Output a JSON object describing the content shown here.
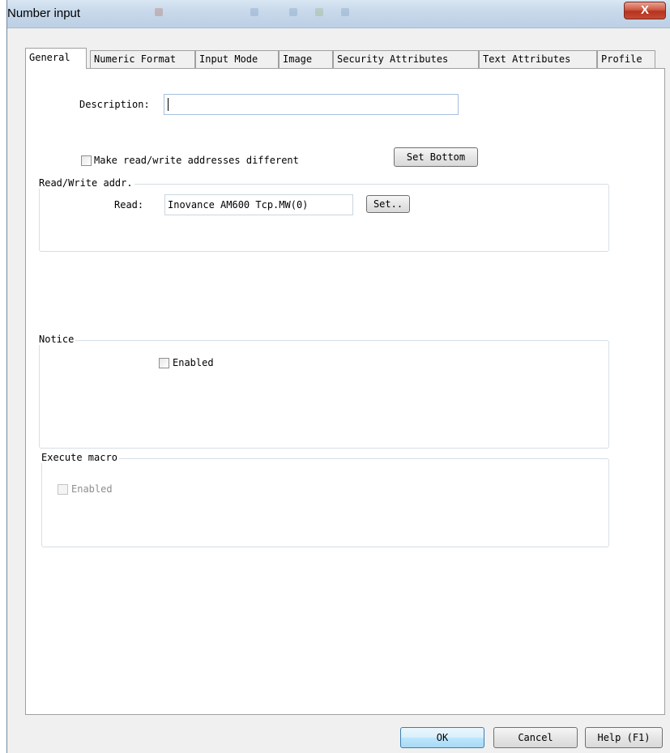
{
  "window": {
    "title": "Number input",
    "close_glyph": "X"
  },
  "tabs": [
    {
      "label": "General",
      "active": true
    },
    {
      "label": "Numeric Format",
      "active": false
    },
    {
      "label": "Input Mode",
      "active": false
    },
    {
      "label": "Image",
      "active": false
    },
    {
      "label": "Security Attributes",
      "active": false
    },
    {
      "label": "Text Attributes",
      "active": false
    },
    {
      "label": "Profile",
      "active": false
    }
  ],
  "general": {
    "description_label": "Description:",
    "description_value": "",
    "make_rw_different_label": "Make read/write addresses different",
    "make_rw_different_checked": false,
    "set_bottom_label": "Set Bottom",
    "rw_group": {
      "title": "Read/Write addr.",
      "read_label": "Read:",
      "read_value": "Inovance AM600 Tcp.MW(0)",
      "set_label": "Set.."
    },
    "notice_group": {
      "title": "Notice",
      "enabled_label": "Enabled",
      "enabled_checked": false
    },
    "macro_group": {
      "title": "Execute macro",
      "enabled_label": "Enabled",
      "enabled_checked": false,
      "enabled_disabled": true
    }
  },
  "footer": {
    "ok_label": "OK",
    "cancel_label": "Cancel",
    "help_label": "Help (F1)"
  },
  "colors": {
    "title_bar": "#c7d8ea",
    "close_button": "#c44a33",
    "ok_button_highlight": "#bee6fd"
  }
}
